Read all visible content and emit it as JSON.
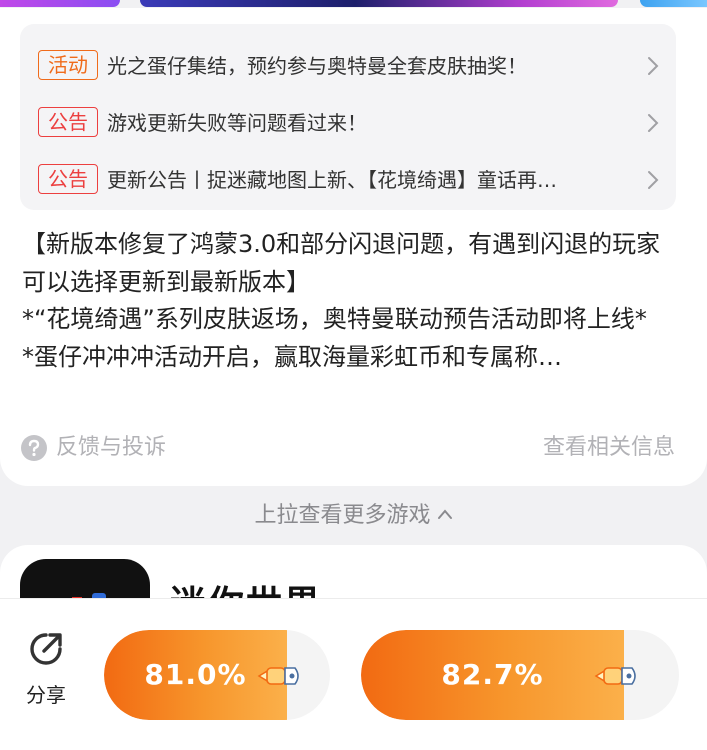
{
  "notices": [
    {
      "tag": "活动",
      "tag_color": "#f06b1b",
      "text": "光之蛋仔集结，预约参与奥特曼全套皮肤抽奖！"
    },
    {
      "tag": "公告",
      "tag_color": "#ec3f3f",
      "text": "游戏更新失败等问题看过来！"
    },
    {
      "tag": "公告",
      "tag_color": "#ec3f3f",
      "text": "更新公告丨捉迷藏地图上新、【花境绮遇】童话再…"
    }
  ],
  "description": {
    "line1": "【新版本修复了鸿蒙3.0和部分闪退问题，有遇到闪退的玩家可以选择更新到最新版本】",
    "line2": "*“花境绮遇”系列皮肤返场，奥特曼联动预告活动即将上线*",
    "line3": "*蛋仔冲冲冲活动开启，赢取海量彩虹币和专属称…"
  },
  "feedback": {
    "icon": "question-circle-icon",
    "label": "反馈与投诉"
  },
  "related_info": "查看相关信息",
  "pull_more": "上拉查看更多游戏",
  "next_game": {
    "title": "迷你世界"
  },
  "bottom": {
    "share_icon": "share-arrow-icon",
    "share_label": "分享",
    "download_1": {
      "progress_text": "81.0%",
      "progress": 0.81
    },
    "download_2": {
      "progress_text": "82.7%",
      "progress": 0.827
    }
  },
  "colors": {
    "accent": "#f26a12",
    "accent_light": "#fbb04a",
    "activity_tag": "#f06b1b",
    "notice_tag": "#ec3f3f"
  }
}
